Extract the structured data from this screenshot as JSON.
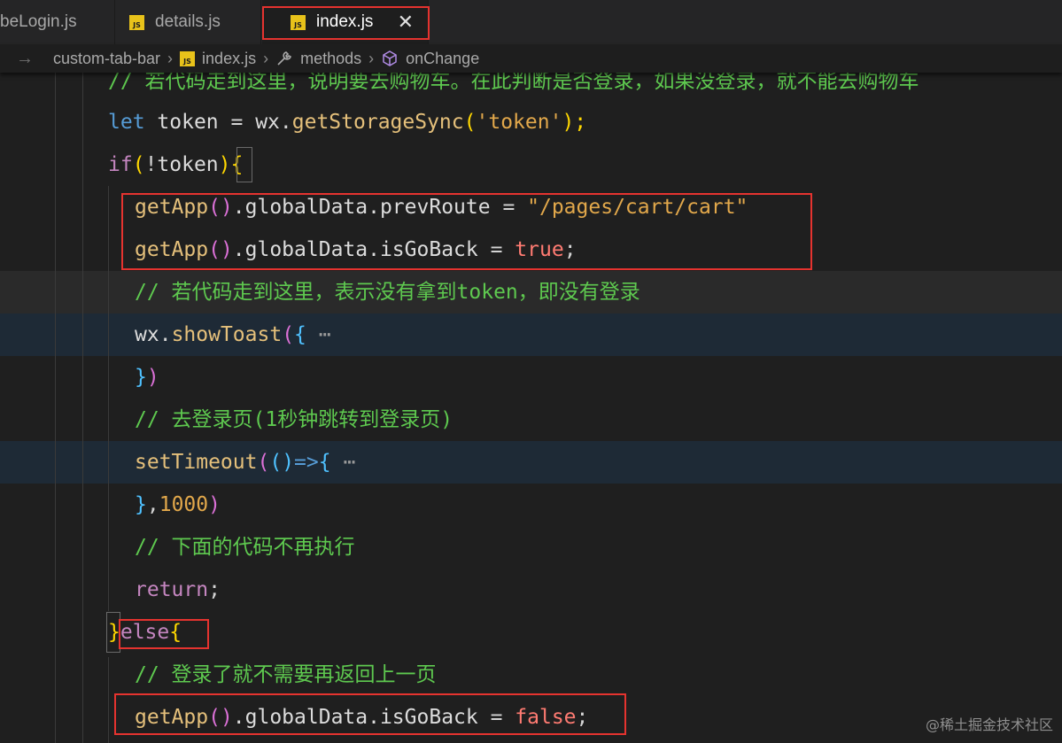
{
  "tabs": [
    {
      "label": "beLogin.js",
      "active": false
    },
    {
      "label": "details.js",
      "active": false
    },
    {
      "label": "index.js",
      "active": true
    }
  ],
  "file_badge": "JS",
  "close_glyph": "✕",
  "breadcrumb": {
    "items": [
      "custom-tab-bar",
      "index.js",
      "methods",
      "onChange"
    ]
  },
  "code": {
    "line0_comment": "// 若代码走到这里，说明要去购物车。在此判断是否登录，如果没登录，就不能去购物车",
    "line1": {
      "kw": "let",
      "var": "token",
      "op": " = ",
      "obj": "wx",
      "fn": "getStorageSync",
      "str": "'token'",
      "end": ");"
    },
    "line2": {
      "kw": "if",
      "open": "(",
      "not": "!",
      "var": "token",
      "close": ")",
      "brace": "{"
    },
    "line3": {
      "fn": "getApp",
      "parens": "()",
      "rest": ".globalData.prevRoute",
      "op": " = ",
      "str": "\"/pages/cart/cart\""
    },
    "line4": {
      "fn": "getApp",
      "parens": "()",
      "rest": ".globalData.isGoBack",
      "op": " = ",
      "bool": "true",
      "end": ";"
    },
    "line5_comment": "// 若代码走到这里，表示没有拿到token，即没有登录",
    "line6": {
      "obj": "wx",
      "fn": "showToast",
      "open": "(",
      "brace": "{",
      "ellipsis": " ⋯"
    },
    "line7": {
      "brace": "}",
      "close": ")"
    },
    "line8_comment": "// 去登录页(1秒钟跳转到登录页)",
    "line9": {
      "fn": "setTimeout",
      "open": "(",
      "inner": "()",
      "arrow": "=>",
      "brace": "{",
      "ellipsis": " ⋯"
    },
    "line10": {
      "brace": "}",
      "comma": ",",
      "num": "1000",
      "close": ")"
    },
    "line11_comment": "// 下面的代码不再执行",
    "line12": {
      "kw": "return",
      "end": ";"
    },
    "line13": {
      "close": "}",
      "kw": "else",
      "brace": "{"
    },
    "line14_comment": "// 登录了就不需要再返回上一页",
    "line15": {
      "fn": "getApp",
      "parens": "()",
      "rest": ".globalData.isGoBack",
      "op": " = ",
      "bool": "false",
      "end": ";"
    }
  },
  "watermark": "@稀土掘金技术社区",
  "colors": {
    "highlight_box": "#e5332f",
    "comment": "#5ec94f",
    "js_badge": "#e8c21a"
  }
}
